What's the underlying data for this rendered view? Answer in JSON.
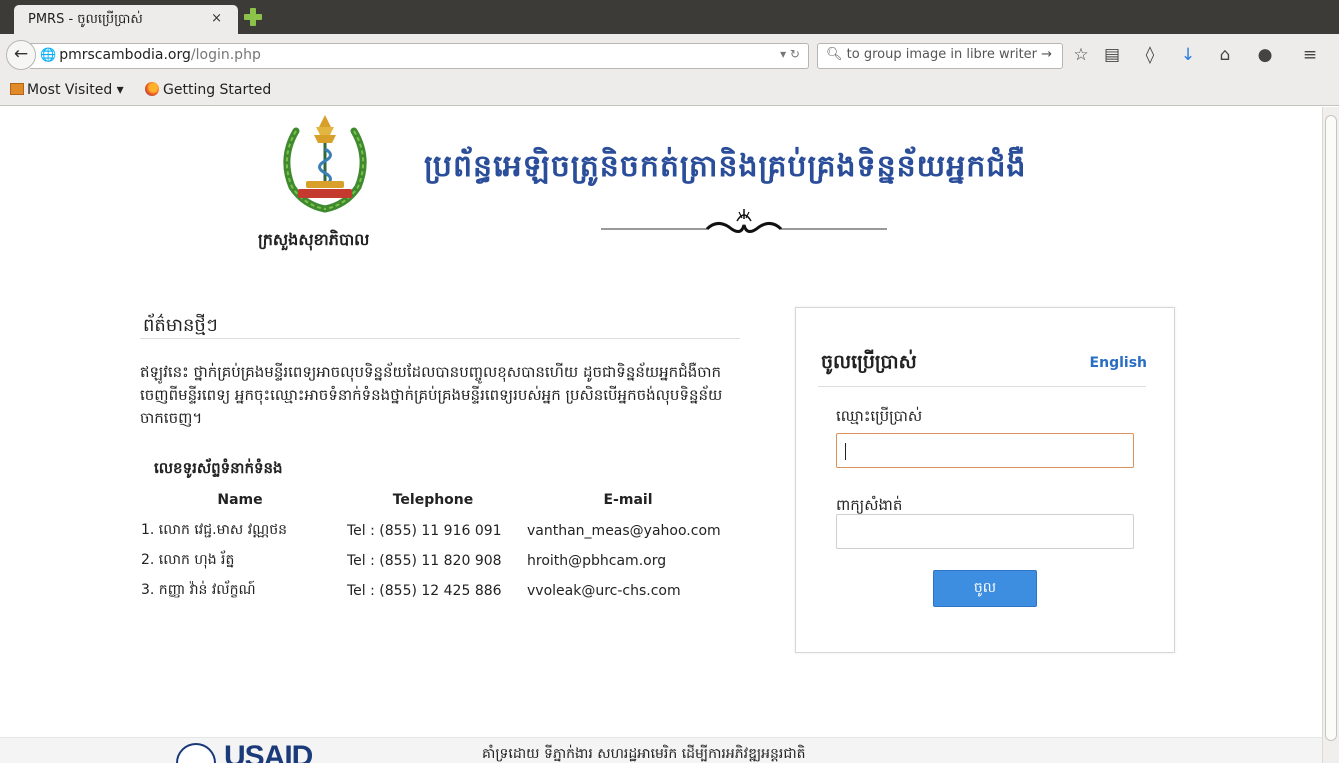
{
  "browser": {
    "tab_title": "PMRS - ចូលប្រើប្រាស់",
    "tab_close": "×",
    "url_host": "pmrscambodia.org",
    "url_path": "/login.php",
    "search_text": "to group image in libre writer",
    "bookmarks": {
      "most_visited": "Most Visited ▾",
      "getting_started": "Getting Started"
    }
  },
  "header": {
    "ministry": "ក្រសួងសុខាភិបាល",
    "site_title": "ប្រព័ន្ធអេឡិចត្រូនិចកត់ត្រានិងគ្រប់គ្រងទិន្នន័យអ្នកជំងឺ"
  },
  "news": {
    "title": "ព័ត៌មានថ្មីៗ",
    "body": "ឥឡូវនេះ ថ្នាក់គ្រប់គ្រងមន្ទីរពេទ្យអាចលុបទិន្នន័យដែលបានបញ្ចូលខុសបានហើយ ដូចជាទិន្នន័យអ្នកជំងឺចាកចេញពីមន្ទីរពេទ្យ អ្នកចុះឈ្មោះអាចទំនាក់ទំនងថ្នាក់គ្រប់គ្រងមន្ទីរពេទ្យរបស់អ្នក ប្រសិនបើអ្នកចង់លុបទិន្នន័យចាកចេញ។",
    "contact_title": "លេខទូរស័ព្ទទំនាក់ទំនង",
    "columns": [
      "Name",
      "Telephone",
      "E-mail"
    ],
    "contacts": [
      {
        "name": "1. លោក វេជ្ជ.មាស វណ្ណថន",
        "phone": "Tel : (855) 11 916 091",
        "email": "vanthan_meas@yahoo.com"
      },
      {
        "name": "2. លោក ហុង រ័ត្ន",
        "phone": "Tel : (855) 11 820 908",
        "email": "hroith@pbhcam.org"
      },
      {
        "name": "3. កញ្ញា វ៉ាន់ វល័ក្ខណ៍",
        "phone": "Tel : (855) 12 425 886",
        "email": "vvoleak@urc-chs.com"
      }
    ]
  },
  "login": {
    "title": "ចូលប្រើប្រាស់",
    "language_link": "English",
    "username_label": "ឈ្មោះប្រើប្រាស់",
    "username_value": "",
    "password_label": "ពាក្យសំងាត់",
    "password_value": "",
    "submit_label": "ចូល"
  },
  "footer": {
    "usaid": "USAID",
    "text": "គាំទ្រដោយ ទីភ្នាក់ងារ សហរដ្ឋអាមេរិក ដើម្បីការអភិវឌ្ឍអន្តរជាតិ"
  },
  "colors": {
    "title_blue": "#2b4e9a",
    "link_blue": "#2a6ec3",
    "button_blue": "#3d8de0",
    "focus_border": "#d9925e"
  }
}
